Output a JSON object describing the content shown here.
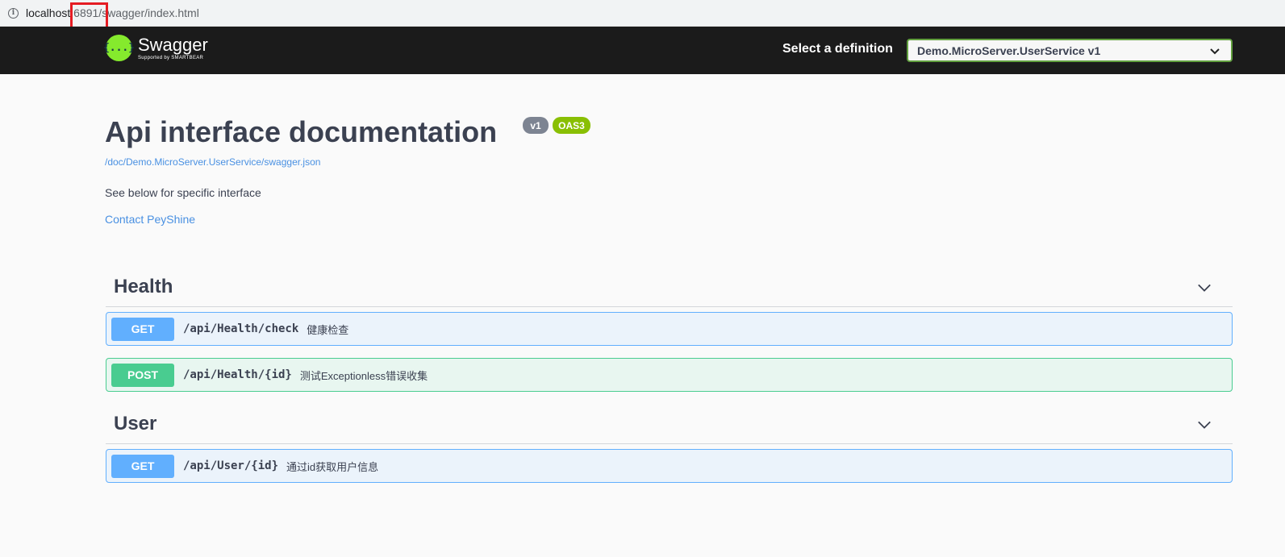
{
  "browser": {
    "url_host": "localhost:",
    "url_rest": "6891/swagger/index.html"
  },
  "topbar": {
    "logo_title": "Swagger",
    "logo_subtitle": "Supported by SMARTBEAR",
    "logo_glyph": "{...}",
    "definition_label": "Select a definition",
    "definition_selected": "Demo.MicroServer.UserService v1"
  },
  "info": {
    "title": "Api interface documentation",
    "version_badge": "v1",
    "spec_badge": "OAS3",
    "spec_url": "/doc/Demo.MicroServer.UserService/swagger.json",
    "description": "See below for specific interface",
    "contact": "Contact PeyShine"
  },
  "tags": [
    {
      "name": "Health",
      "operations": [
        {
          "method": "GET",
          "path": "/api/Health/check",
          "summary": "健康检查"
        },
        {
          "method": "POST",
          "path": "/api/Health/{id}",
          "summary": "测试Exceptionless错误收集"
        }
      ]
    },
    {
      "name": "User",
      "operations": [
        {
          "method": "GET",
          "path": "/api/User/{id}",
          "summary": "通过id获取用户信息"
        }
      ]
    }
  ],
  "colors": {
    "get": "#61affe",
    "post": "#49cc90",
    "topbar": "#1b1b1b",
    "logo": "#85ea2d",
    "highlight": "#e51c23"
  }
}
